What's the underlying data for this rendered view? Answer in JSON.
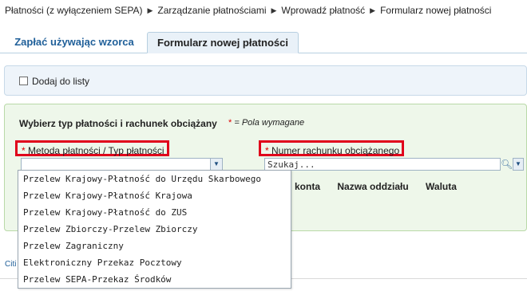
{
  "breadcrumb": {
    "items": [
      "Płatności (z wyłączeniem SEPA)",
      "Zarządzanie płatnościami",
      "Wprowadź płatność",
      "Formularz nowej płatności"
    ],
    "separator": "▶"
  },
  "tabs": [
    {
      "label": "Zapłać używając wzorca",
      "active": false
    },
    {
      "label": "Formularz nowej płatności",
      "active": true
    }
  ],
  "list_toggle": {
    "label": "Dodaj do listy",
    "checked": false
  },
  "form": {
    "section_title": "Wybierz typ płatności i rachunek obciążany",
    "required_star": "*",
    "required_note": "= Pola wymagane",
    "method_label": "Metoda płatności / Typ płatności",
    "account_label": "Numer rachunku obciążanego",
    "search_placeholder": "Szukaj...",
    "table_headers": [
      "konta",
      "Nazwa oddziału",
      "Waluta"
    ]
  },
  "dropdown_options": [
    "Przelew Krajowy-Płatność do Urzędu Skarbowego",
    "Przelew Krajowy-Płatność Krajowa",
    "Przelew Krajowy-Płatność do ZUS",
    "Przelew Zbiorczy-Przelew Zbiorczy",
    "Przelew Zagraniczny",
    "Elektroniczny Przekaz Pocztowy",
    "Przelew SEPA-Przekaz Środków"
  ],
  "below_link": "Citi",
  "colors": {
    "highlight_border": "#e0001b",
    "form_panel_bg": "#eef7ea",
    "list_box_bg": "#eef4fa",
    "tab_text": "#1f5f99",
    "required_star": "#d00"
  }
}
